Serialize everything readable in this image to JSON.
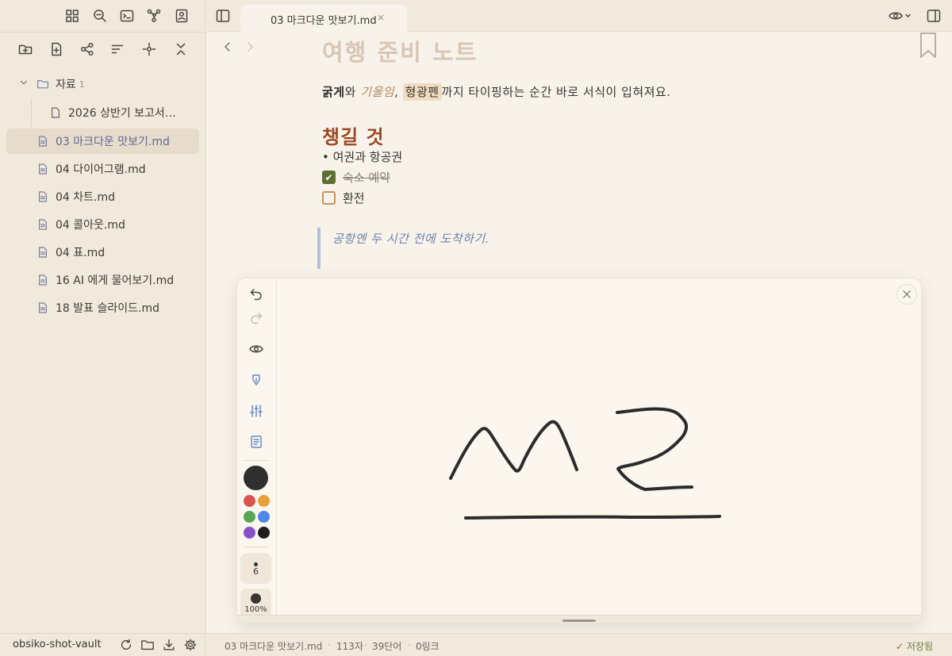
{
  "sidebar": {
    "vault_name": "obsiko-shot-vault",
    "folder": {
      "name": "자료",
      "count": "1",
      "children": [
        "2026 상반기 보고서…"
      ]
    },
    "files": [
      {
        "label": "03 마크다운 맛보기.md",
        "active": true
      },
      {
        "label": "04 다이어그램.md"
      },
      {
        "label": "04 차트.md"
      },
      {
        "label": "04 콜아웃.md"
      },
      {
        "label": "04 표.md"
      },
      {
        "label": "16 AI 에게 물어보기.md"
      },
      {
        "label": "18 발표 슬라이드.md"
      }
    ]
  },
  "tabs": [
    {
      "title": "03 마크다운 맛보기.md",
      "close": "×"
    }
  ],
  "document": {
    "title": "여행 준비 노트",
    "para": {
      "bold": "굵게",
      "t1": "와 ",
      "italic": "기울임",
      "t2": ", ",
      "highlight": "형광펜",
      "t3": "까지 타이핑하는 순간 바로 서식이 입혀져요."
    },
    "heading": "챙길 것",
    "bullet": "여권과 항공권",
    "tasks": [
      {
        "text": "숙소 예약",
        "done": true
      },
      {
        "text": "환전",
        "done": false
      }
    ],
    "quote": "공항엔 두 시간 전에 도착하기."
  },
  "drawing": {
    "brush_size": "6",
    "opacity": "100%",
    "current_color": "#2f2f2f",
    "palette": [
      "#d9534f",
      "#e8a23a",
      "#5aa457",
      "#4f86e8",
      "#8a4fc8",
      "#1e1e1e"
    ]
  },
  "status": {
    "file": "03 마크다운 맛보기.md",
    "chars": "113자",
    "words": "39단어",
    "links": "0링크",
    "saved": "✓ 저장됨"
  }
}
